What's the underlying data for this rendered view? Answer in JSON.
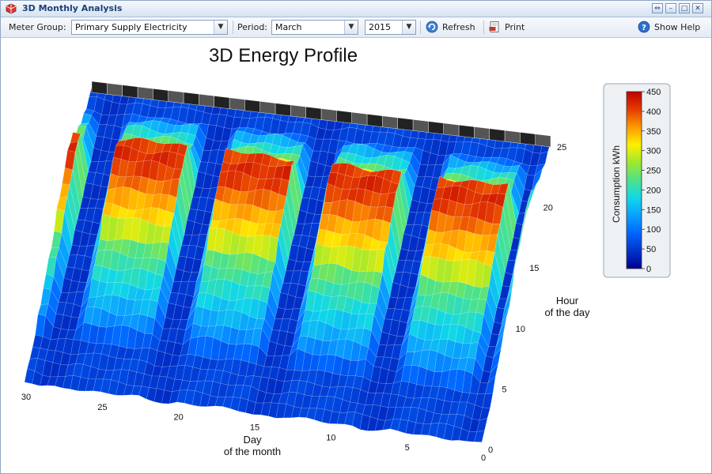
{
  "window": {
    "title": "3D Monthly Analysis"
  },
  "toolbar": {
    "meter_group_label": "Meter Group:",
    "meter_group_value": "Primary Supply Electricity",
    "period_label": "Period:",
    "period_value": "March",
    "year_value": "2015",
    "refresh_label": "Refresh",
    "print_label": "Print",
    "help_label": "Show Help"
  },
  "icons": {
    "app": "app-icon",
    "pin": "pin-icon",
    "minimize": "minimize-icon",
    "maximize": "maximize-icon",
    "close": "close-icon",
    "refresh": "refresh-icon",
    "print": "print-icon",
    "help": "help-icon",
    "dropdown": "chevron-down-icon"
  },
  "chart_data": {
    "type": "surface",
    "title": "3D Energy Profile",
    "xlabel": [
      "Day",
      "of the month"
    ],
    "ylabel": [
      "Hour",
      "of the day"
    ],
    "x_ticks": [
      "0",
      "5",
      "10",
      "15",
      "20",
      "25",
      "30"
    ],
    "y_ticks": [
      "0",
      "5",
      "10",
      "15",
      "20",
      "25"
    ],
    "xlim": [
      0,
      30
    ],
    "ylim": [
      0,
      25
    ],
    "colorbar": {
      "label": "Consumption kWh",
      "ticks": [
        "0",
        "50",
        "100",
        "150",
        "200",
        "250",
        "300",
        "350",
        "400",
        "450"
      ],
      "range": [
        0,
        450
      ],
      "colors": [
        "#00008f",
        "#0033cc",
        "#0066ff",
        "#0aa0ff",
        "#10d8e8",
        "#4de28a",
        "#9ee82e",
        "#ffef00",
        "#ff9900",
        "#e53b00",
        "#c00000"
      ]
    },
    "weekend_days": [
      1,
      7,
      8,
      14,
      15,
      21,
      22,
      28,
      29
    ],
    "levels": {
      "night_kwh": 60,
      "weekend_kwh": 45,
      "office_peak_kwh": 430,
      "morning_kwh": 330,
      "evening_kwh": 250
    },
    "grid": true
  }
}
